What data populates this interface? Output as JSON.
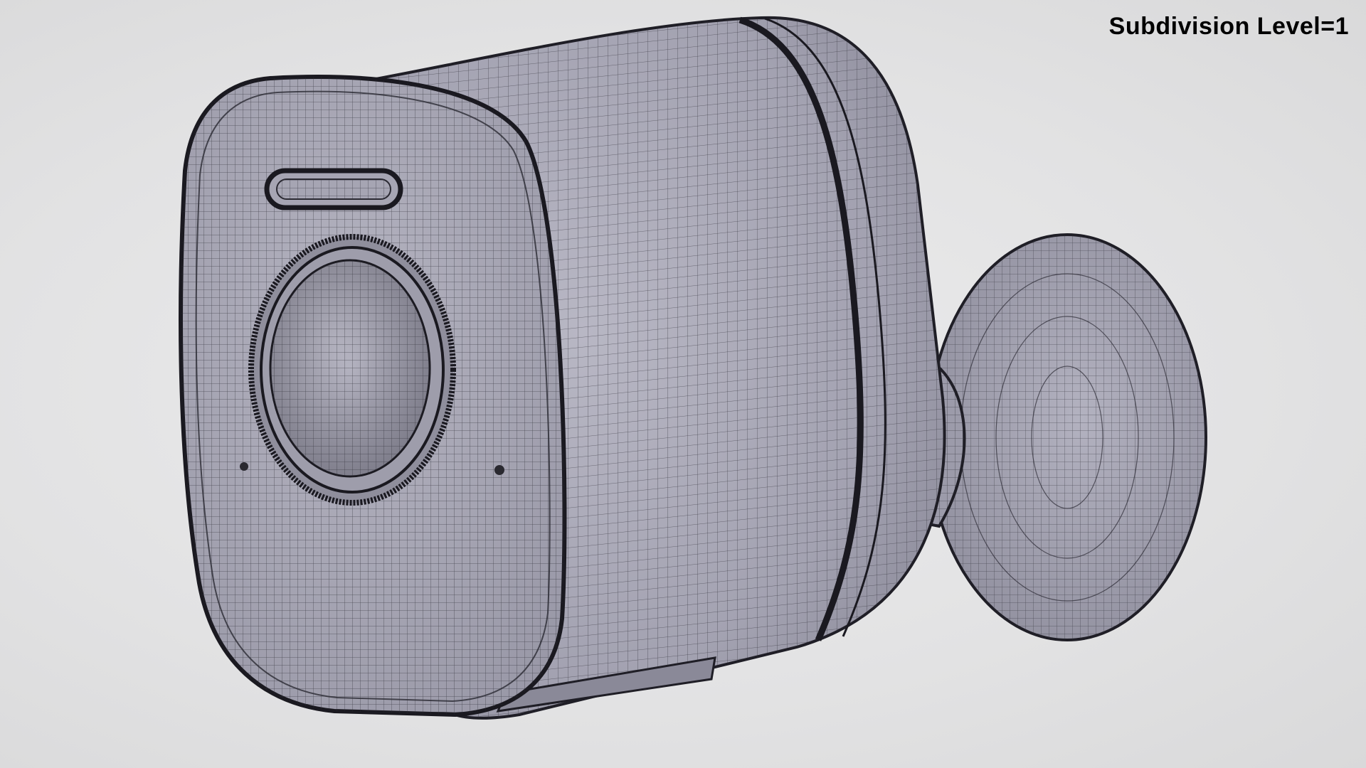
{
  "overlay": {
    "label": "Subdivision Level=1"
  },
  "render": {
    "subject": "camera-wireframe-render",
    "colors": {
      "background": "#e3e3e4",
      "surface": "#a9a8b6",
      "wire": "#2b2a33",
      "label": "#000000"
    }
  }
}
